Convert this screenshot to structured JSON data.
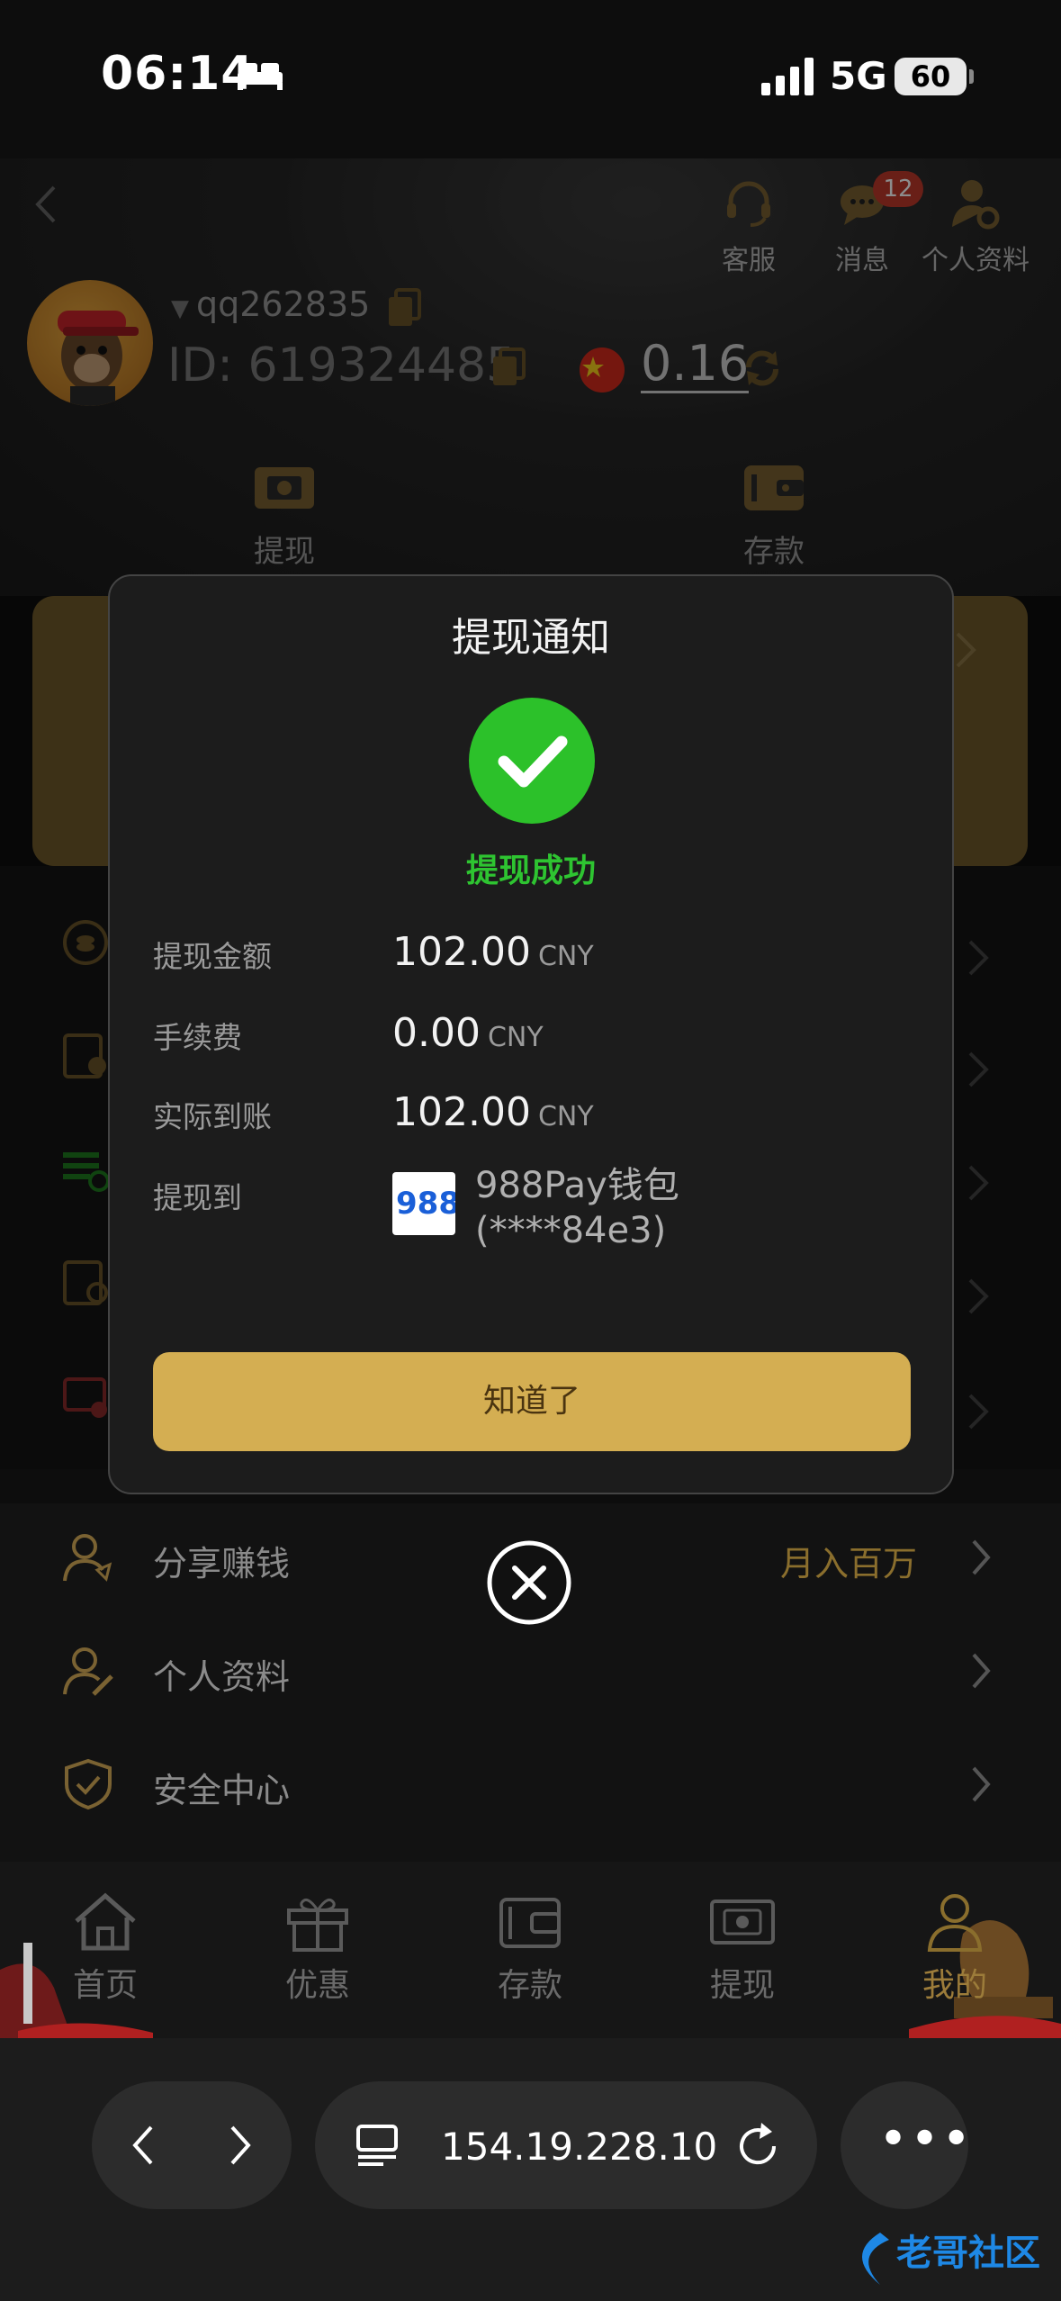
{
  "status_bar": {
    "time": "06:14",
    "network": "5G",
    "battery": "60"
  },
  "header": {
    "icons": [
      {
        "name": "customer-service-icon",
        "label": "客服"
      },
      {
        "name": "message-icon",
        "label": "消息",
        "badge": "12"
      },
      {
        "name": "profile-settings-icon",
        "label": "个人资料"
      }
    ]
  },
  "user": {
    "username": "qq262835",
    "id_label": "ID:",
    "id": "619324485",
    "balance": "0.16"
  },
  "quick_actions": [
    {
      "label": "提现",
      "icon": "withdraw-icon"
    },
    {
      "label": "存款",
      "icon": "deposit-icon"
    }
  ],
  "menu_secondary": [
    {
      "label": "分享赚钱",
      "right": "月入百万",
      "icon": "share-earn-icon"
    },
    {
      "label": "个人资料",
      "right": "",
      "icon": "edit-profile-icon"
    },
    {
      "label": "安全中心",
      "right": "",
      "icon": "shield-icon"
    }
  ],
  "tabbar": [
    {
      "label": "首页",
      "icon": "home-icon",
      "active": false
    },
    {
      "label": "优惠",
      "icon": "gift-icon",
      "active": false
    },
    {
      "label": "存款",
      "icon": "wallet-icon",
      "active": false
    },
    {
      "label": "提现",
      "icon": "withdraw-icon",
      "active": false
    },
    {
      "label": "我的",
      "icon": "user-icon",
      "active": true
    }
  ],
  "browser": {
    "url": "154.19.228.10"
  },
  "watermark": "老哥社区",
  "modal": {
    "title": "提现通知",
    "status": "提现成功",
    "rows": [
      {
        "label": "提现金额",
        "value": "102.00",
        "unit": "CNY"
      },
      {
        "label": "手续费",
        "value": "0.00",
        "unit": "CNY"
      },
      {
        "label": "实际到账",
        "value": "102.00",
        "unit": "CNY"
      }
    ],
    "destination_label": "提现到",
    "destination_name": "988Pay钱包",
    "destination_account": "(****84e3)",
    "logo_text": "988",
    "ok_button": "知道了"
  },
  "colors": {
    "accent_gold": "#d4ae52",
    "success_green": "#2ec431",
    "badge_red": "#c0392b"
  }
}
